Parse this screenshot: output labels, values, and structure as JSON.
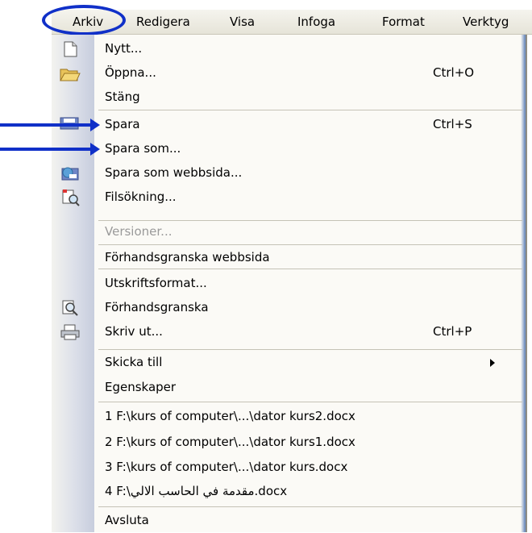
{
  "menubar": {
    "items": [
      "Arkiv",
      "Redigera",
      "Visa",
      "Infoga",
      "Format",
      "Verktyg"
    ]
  },
  "file_menu": {
    "items": [
      {
        "label": "Nytt...",
        "icon": "new-document-icon"
      },
      {
        "label": "Öppna...",
        "shortcut": "Ctrl+O",
        "icon": "open-folder-icon"
      },
      {
        "label": "Stäng"
      },
      {
        "label": "Spara",
        "shortcut": "Ctrl+S",
        "icon": "save-icon"
      },
      {
        "label": "Spara som..."
      },
      {
        "label": "Spara som webbsida...",
        "icon": "save-web-icon"
      },
      {
        "label": "Filsökning...",
        "icon": "file-search-icon"
      },
      {
        "label": "Versioner...",
        "disabled": true
      },
      {
        "label": "Förhandsgranska webbsida"
      },
      {
        "label": "Utskriftsformat..."
      },
      {
        "label": "Förhandsgranska",
        "icon": "print-preview-icon"
      },
      {
        "label": "Skriv ut...",
        "shortcut": "Ctrl+P",
        "icon": "print-icon"
      },
      {
        "label": "Skicka till",
        "submenu": true
      },
      {
        "label": "Egenskaper"
      },
      {
        "label": "1 F:\\kurs of computer\\...\\dator kurs2.docx"
      },
      {
        "label": "2 F:\\kurs of computer\\...\\dator kurs1.docx"
      },
      {
        "label": "3 F:\\kurs of computer\\...\\dator kurs.docx"
      },
      {
        "label": "4 F:\\مقدمة في الحاسب الالي.docx"
      },
      {
        "label": "Avsluta"
      }
    ]
  },
  "annotation_color": "#1030c8"
}
